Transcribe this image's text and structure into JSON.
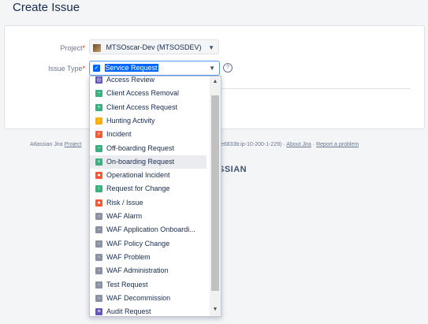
{
  "page": {
    "title": "Create Issue"
  },
  "form": {
    "project_label": "Project",
    "project_value": "MTSOscar-Dev (MTSOSDEV)",
    "issuetype_label": "Issue Type",
    "issuetype_value": "Service Request",
    "required_mark": "*"
  },
  "footer": {
    "left_text": "Atlassian Jira",
    "left_link": "Project",
    "middle_text": "e6833b:ip-10-200-1-229)",
    "about_link": "About Jira",
    "report_link": "Report a problem",
    "sep": "·",
    "brand_partial": "SSIAN"
  },
  "dropdown": {
    "options": [
      {
        "label": "Access Review",
        "color": "#6554c0",
        "icon": "review-icon",
        "glyph": "◎"
      },
      {
        "label": "Client Access Removal",
        "color": "#36b37e",
        "icon": "minus-icon",
        "glyph": "−"
      },
      {
        "label": "Client Access Request",
        "color": "#36b37e",
        "icon": "plus-icon",
        "glyph": "+"
      },
      {
        "label": "Hunting Activity",
        "color": "#ffab00",
        "icon": "alert-icon",
        "glyph": "!"
      },
      {
        "label": "Incident",
        "color": "#ff5630",
        "icon": "incident-icon",
        "glyph": "⚡"
      },
      {
        "label": "Off-boarding Request",
        "color": "#36b37e",
        "icon": "minus-icon",
        "glyph": "−"
      },
      {
        "label": "On-boarding Request",
        "color": "#36b37e",
        "icon": "plus-icon",
        "glyph": "+"
      },
      {
        "label": "Operational Incident",
        "color": "#ff5630",
        "icon": "stop-icon",
        "glyph": "●"
      },
      {
        "label": "Request for Change",
        "color": "#36b37e",
        "icon": "arrow-up-icon",
        "glyph": "↑"
      },
      {
        "label": "Risk / Issue",
        "color": "#ff5630",
        "icon": "risk-icon",
        "glyph": "●"
      },
      {
        "label": "WAF Alarm",
        "color": "#8993a4",
        "icon": "waf-icon",
        "glyph": "◦"
      },
      {
        "label": "WAF Application Onboardi...",
        "color": "#8993a4",
        "icon": "waf-icon",
        "glyph": "◦"
      },
      {
        "label": "WAF Policy Change",
        "color": "#8993a4",
        "icon": "waf-icon",
        "glyph": "◦"
      },
      {
        "label": "WAF Problem",
        "color": "#8993a4",
        "icon": "waf-icon",
        "glyph": "◦"
      },
      {
        "label": "WAF Administration",
        "color": "#8993a4",
        "icon": "waf-icon",
        "glyph": "◦"
      },
      {
        "label": "Test Request",
        "color": "#8993a4",
        "icon": "test-icon",
        "glyph": "◦"
      },
      {
        "label": "WAF Decommission",
        "color": "#8993a4",
        "icon": "waf-icon",
        "glyph": "◦"
      },
      {
        "label": "Audit Request",
        "color": "#6554c0",
        "icon": "audit-icon",
        "glyph": "≡"
      }
    ],
    "hovered_index": 6
  },
  "colors": {
    "accent": "#0065ff",
    "required": "#de350b"
  }
}
